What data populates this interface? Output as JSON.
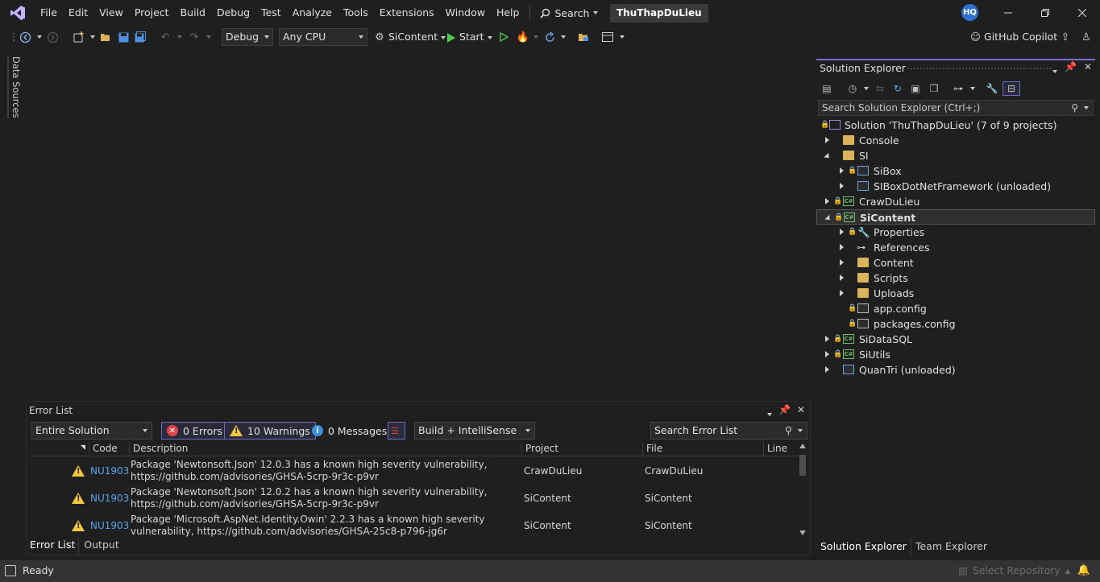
{
  "titlebar": {
    "menu": [
      "File",
      "Edit",
      "View",
      "Project",
      "Build",
      "Debug",
      "Test",
      "Analyze",
      "Tools",
      "Extensions",
      "Window",
      "Help"
    ],
    "search_label": "Search",
    "solution_name": "ThuThapDuLieu",
    "avatar_initials": "HQ"
  },
  "toolbar": {
    "config": "Debug",
    "platform": "Any CPU",
    "startup_project": "SiContent",
    "start_label": "Start",
    "copilot_label": "GitHub Copilot"
  },
  "left_strip": {
    "data_sources": "Data Sources"
  },
  "error_list": {
    "title": "Error List",
    "scope": "Entire Solution",
    "errors": "0 Errors",
    "warnings": "10 Warnings",
    "messages": "0 Messages",
    "source": "Build + IntelliSense",
    "search_placeholder": "Search Error List",
    "columns": {
      "code": "Code",
      "description": "Description",
      "project": "Project",
      "file": "File",
      "line": "Line"
    },
    "rows": [
      {
        "code": "NU1903",
        "description": "Package 'Newtonsoft.Json' 12.0.3 has a known high severity vulnerability, https://github.com/advisories/GHSA-5crp-9r3c-p9vr",
        "project": "CrawDuLieu",
        "file": "CrawDuLieu"
      },
      {
        "code": "NU1903",
        "description": "Package 'Newtonsoft.Json' 12.0.2 has a known high severity vulnerability, https://github.com/advisories/GHSA-5crp-9r3c-p9vr",
        "project": "SiContent",
        "file": "SiContent"
      },
      {
        "code": "NU1903",
        "description": "Package 'Microsoft.AspNet.Identity.Owin' 2.2.3 has a known high severity vulnerability, https://github.com/advisories/GHSA-25c8-p796-jg6r",
        "project": "SiContent",
        "file": "SiContent"
      }
    ],
    "tabs": [
      "Error List",
      "Output"
    ]
  },
  "solution_explorer": {
    "title": "Solution Explorer",
    "search_placeholder": "Search Solution Explorer (Ctrl+;)",
    "tree": [
      {
        "label": "Solution 'ThuThapDuLieu' (7 of 9 projects)"
      },
      {
        "label": "Console"
      },
      {
        "label": "SI"
      },
      {
        "label": "SiBox"
      },
      {
        "label": "SIBoxDotNetFramework (unloaded)"
      },
      {
        "label": "CrawDuLieu"
      },
      {
        "label": "SiContent"
      },
      {
        "label": "Properties"
      },
      {
        "label": "References"
      },
      {
        "label": "Content"
      },
      {
        "label": "Scripts"
      },
      {
        "label": "Uploads"
      },
      {
        "label": "app.config"
      },
      {
        "label": "packages.config"
      },
      {
        "label": "SiDataSQL"
      },
      {
        "label": "SiUtils"
      },
      {
        "label": "QuanTri (unloaded)"
      }
    ],
    "tabs": [
      "Solution Explorer",
      "Team Explorer"
    ]
  },
  "statusbar": {
    "status": "Ready",
    "repo": "Select Repository"
  }
}
